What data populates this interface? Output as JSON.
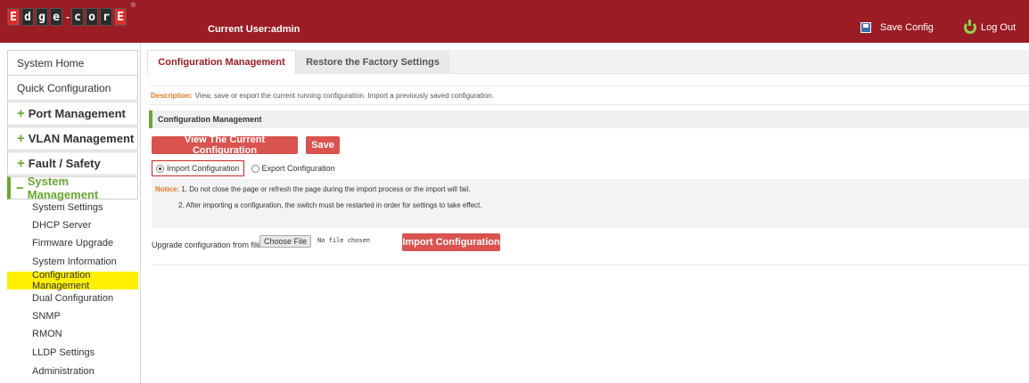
{
  "header": {
    "logo_letters": [
      "E",
      "d",
      "g",
      "e",
      "c",
      "o",
      "r",
      "E"
    ],
    "logo_dash": "-",
    "current_user": "Current User:admin",
    "save_config": "Save Config",
    "log_out": "Log Out"
  },
  "sidebar": {
    "system_home": "System Home",
    "quick_configuration": "Quick Configuration",
    "groups": [
      {
        "label": "Port Management",
        "symbol": "+"
      },
      {
        "label": "VLAN Management",
        "symbol": "+"
      },
      {
        "label": "Fault / Safety",
        "symbol": "+"
      },
      {
        "label": "System Management",
        "symbol": "−"
      }
    ],
    "sub_items": [
      "System Settings",
      "DHCP Server",
      "Firmware Upgrade",
      "System Information",
      "Configuration Management",
      "Dual Configuration",
      "SNMP",
      "RMON",
      "LLDP Settings",
      "Administration"
    ],
    "selected_sub_item": "Configuration Management"
  },
  "tabs": {
    "active": "Configuration Management",
    "inactive": "Restore the Factory Settings"
  },
  "description": {
    "label": "Description:",
    "text": "View, save or export the current running configuration. Import a previously saved configuration."
  },
  "section_title": "Configuration Management",
  "buttons": {
    "view_current": "View The Current Configuration",
    "save": "Save",
    "import": "Import Configuration"
  },
  "radios": {
    "import": "Import Configuration",
    "export": "Export Configuration",
    "selected": "import"
  },
  "notice": {
    "label": "Notice:",
    "line1": "1. Do not close the page or refresh the page during the import process or the import will fail.",
    "line2": "2. After importing a configuration, the switch must be restarted in order for settings to take effect."
  },
  "upgrade": {
    "label": "Upgrade configuration from file :",
    "choose_file": "Choose File",
    "no_file": "No file chosen"
  },
  "colors": {
    "brand_red": "#9b1c24",
    "button_red": "#d9534f",
    "accent_green": "#6aa830",
    "highlight_yellow": "#ffef00",
    "label_orange": "#e87722"
  }
}
